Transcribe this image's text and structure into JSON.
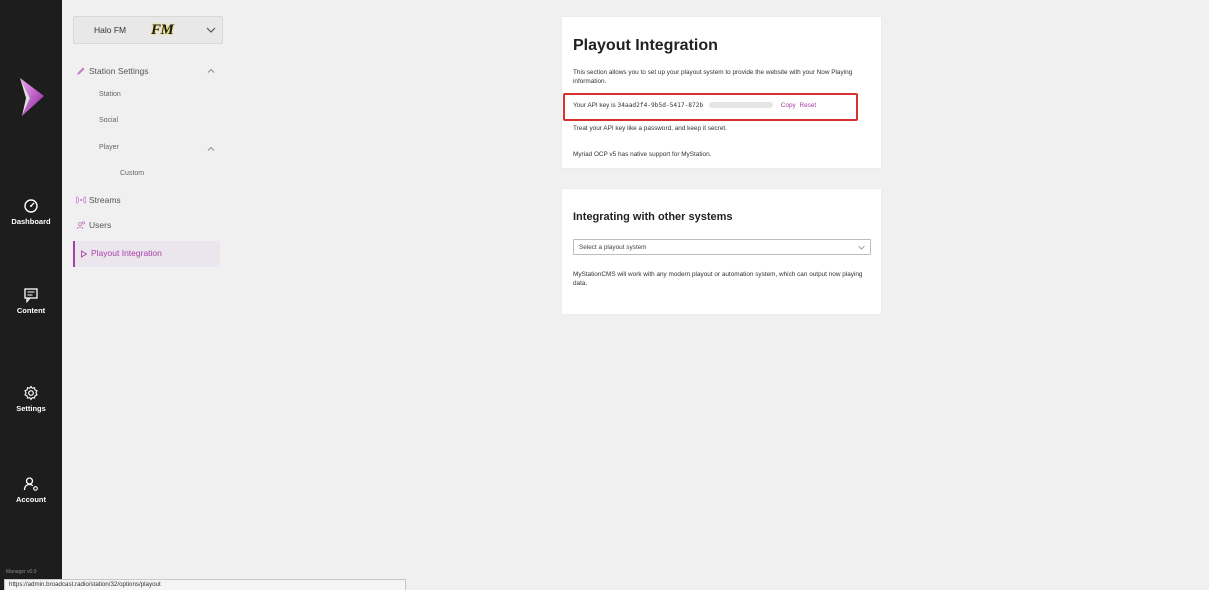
{
  "rail": {
    "items": [
      {
        "label": "Dashboard",
        "icon": "dashboard-gauge-icon"
      },
      {
        "label": "Content",
        "icon": "content-chat-icon"
      },
      {
        "label": "Settings",
        "icon": "settings-gear-icon"
      },
      {
        "label": "Account",
        "icon": "account-user-icon"
      }
    ],
    "version": "Manager v0.9"
  },
  "station": {
    "name": "Halo FM",
    "logo_text": "FM"
  },
  "nav": {
    "station_settings": "Station Settings",
    "station": "Station",
    "social": "Social",
    "player": "Player",
    "custom": "Custom",
    "streams": "Streams",
    "users": "Users",
    "playout_integration": "Playout Integration"
  },
  "playout": {
    "title": "Playout Integration",
    "intro": "This section allows you to set up your playout system to provide the website with your Now Playing information.",
    "api_prefix": "Your API key is",
    "api_key": "34aad2f4-9b5d-5417-872b",
    "copy": "Copy",
    "reset": "Reset",
    "secret_note": "Treat your API key like a password, and keep it secret.",
    "myriad_note": "Myriad OCP v5 has native support for MyStation."
  },
  "integrating": {
    "title": "Integrating with other systems",
    "select_placeholder": "Select a playout system",
    "note": "MyStationCMS will work with any modern playout or automation system, which can output now playing data."
  },
  "status_url": "https://admin.broadcast.radio/station/32/options/playout",
  "colors": {
    "accent": "#a63fa6",
    "rail": "#1d1d1d",
    "highlight": "#d9312f"
  }
}
